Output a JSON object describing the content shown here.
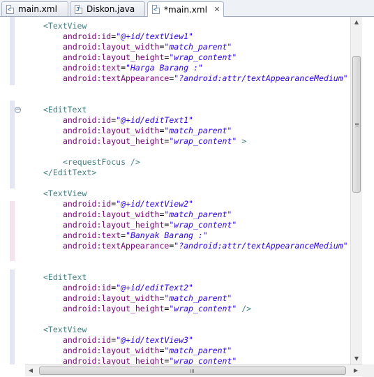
{
  "tabs": [
    {
      "label": "main.xml",
      "icon": "xml-file-icon",
      "glyph": "<",
      "active": false
    },
    {
      "label": "Diskon.java",
      "icon": "java-file-icon",
      "glyph": "J",
      "active": false
    },
    {
      "label": "*main.xml",
      "icon": "xml-file-icon",
      "glyph": "<",
      "active": true,
      "close": "✕"
    }
  ],
  "editor": {
    "fold_marker": "−",
    "lines": [
      [
        {
          "t": "<TextView",
          "c": "tag"
        }
      ],
      [
        {
          "t": "android:id",
          "c": "attr"
        },
        {
          "t": "=",
          "c": "eq"
        },
        {
          "t": "\"@+id/textView1\"",
          "c": "val"
        }
      ],
      [
        {
          "t": "android:layout_width",
          "c": "attr"
        },
        {
          "t": "=",
          "c": "eq"
        },
        {
          "t": "\"match_parent\"",
          "c": "val"
        }
      ],
      [
        {
          "t": "android:layout_height",
          "c": "attr"
        },
        {
          "t": "=",
          "c": "eq"
        },
        {
          "t": "\"wrap_content\"",
          "c": "val"
        }
      ],
      [
        {
          "t": "android:text",
          "c": "attr"
        },
        {
          "t": "=",
          "c": "eq"
        },
        {
          "t": "\"Harga Barang :\"",
          "c": "val"
        }
      ],
      [
        {
          "t": "android:textAppearance",
          "c": "attr"
        },
        {
          "t": "=",
          "c": "eq"
        },
        {
          "t": "\"?android:attr/textAppearanceMedium\"",
          "c": "val"
        }
      ],
      [],
      [],
      [
        {
          "t": "<EditText",
          "c": "tag"
        }
      ],
      [
        {
          "t": "android:id",
          "c": "attr"
        },
        {
          "t": "=",
          "c": "eq"
        },
        {
          "t": "\"@+id/editText1\"",
          "c": "val"
        }
      ],
      [
        {
          "t": "android:layout_width",
          "c": "attr"
        },
        {
          "t": "=",
          "c": "eq"
        },
        {
          "t": "\"match_parent\"",
          "c": "val"
        }
      ],
      [
        {
          "t": "android:layout_height",
          "c": "attr"
        },
        {
          "t": "=",
          "c": "eq"
        },
        {
          "t": "\"wrap_content\"",
          "c": "val"
        },
        {
          "t": " >",
          "c": "tag"
        }
      ],
      [],
      [
        {
          "t": "<requestFocus />",
          "c": "tag"
        }
      ],
      [
        {
          "t": "</EditText>",
          "c": "tag"
        }
      ],
      [],
      [
        {
          "t": "<TextView",
          "c": "tag"
        }
      ],
      [
        {
          "t": "android:id",
          "c": "attr"
        },
        {
          "t": "=",
          "c": "eq"
        },
        {
          "t": "\"@+id/textView2\"",
          "c": "val"
        }
      ],
      [
        {
          "t": "android:layout_width",
          "c": "attr"
        },
        {
          "t": "=",
          "c": "eq"
        },
        {
          "t": "\"match_parent\"",
          "c": "val"
        }
      ],
      [
        {
          "t": "android:layout_height",
          "c": "attr"
        },
        {
          "t": "=",
          "c": "eq"
        },
        {
          "t": "\"wrap_content\"",
          "c": "val"
        }
      ],
      [
        {
          "t": "android:text",
          "c": "attr"
        },
        {
          "t": "=",
          "c": "eq"
        },
        {
          "t": "\"Banyak Barang :\"",
          "c": "val"
        }
      ],
      [
        {
          "t": "android:textAppearance",
          "c": "attr"
        },
        {
          "t": "=",
          "c": "eq"
        },
        {
          "t": "\"?android:attr/textAppearanceMedium\"",
          "c": "val"
        }
      ],
      [],
      [],
      [
        {
          "t": "<EditText",
          "c": "tag"
        }
      ],
      [
        {
          "t": "android:id",
          "c": "attr"
        },
        {
          "t": "=",
          "c": "eq"
        },
        {
          "t": "\"@+id/editText2\"",
          "c": "val"
        }
      ],
      [
        {
          "t": "android:layout_width",
          "c": "attr"
        },
        {
          "t": "=",
          "c": "eq"
        },
        {
          "t": "\"match_parent\"",
          "c": "val"
        }
      ],
      [
        {
          "t": "android:layout_height",
          "c": "attr"
        },
        {
          "t": "=",
          "c": "eq"
        },
        {
          "t": "\"wrap_content\"",
          "c": "val"
        },
        {
          "t": " />",
          "c": "tag"
        }
      ],
      [],
      [
        {
          "t": "<TextView",
          "c": "tag"
        }
      ],
      [
        {
          "t": "android:id",
          "c": "attr"
        },
        {
          "t": "=",
          "c": "eq"
        },
        {
          "t": "\"@+id/textView3\"",
          "c": "val"
        }
      ],
      [
        {
          "t": "android:layout_width",
          "c": "attr"
        },
        {
          "t": "=",
          "c": "eq"
        },
        {
          "t": "\"match_parent\"",
          "c": "val"
        }
      ],
      [
        {
          "t": "android:layout_height",
          "c": "attr"
        },
        {
          "t": "=",
          "c": "eq"
        },
        {
          "t": "\"wrap_content\"",
          "c": "val"
        }
      ]
    ]
  },
  "scrollbars": {
    "up": "▲",
    "down": "▼",
    "left": "◀",
    "right": "▶"
  },
  "colors": {
    "tag": "#3f7f7f",
    "attribute": "#7f007f",
    "value": "#2a00ff"
  }
}
